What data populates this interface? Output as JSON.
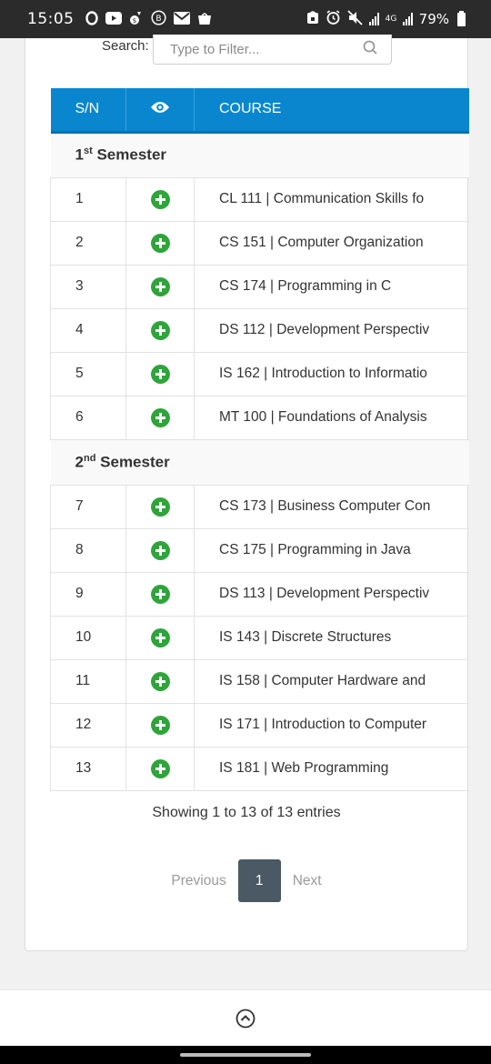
{
  "status_bar": {
    "time": "15:05",
    "left_icons": [
      "o-icon",
      "youtube-icon",
      "money-icon",
      "b-circle-icon",
      "gmail-icon",
      "shopping-bag-icon"
    ],
    "right_icons": [
      "lock-icon",
      "alarm-icon",
      "mute-icon",
      "signal-icon",
      "4g-signal-icon"
    ],
    "network": "4G",
    "battery": "79%"
  },
  "search": {
    "label": "Search:",
    "placeholder": "Type to Filter...",
    "value": ""
  },
  "table": {
    "columns": [
      "S/N",
      "eye-icon",
      "COURSE"
    ],
    "header_color": "#0a86cf",
    "groups": [
      {
        "title_num": "1",
        "title_sup": "st",
        "title_text": " Semester",
        "rows": [
          {
            "sn": "1",
            "course": "CL 111 | Communication Skills fo"
          },
          {
            "sn": "2",
            "course": "CS 151 | Computer Organization"
          },
          {
            "sn": "3",
            "course": "CS 174 | Programming in C"
          },
          {
            "sn": "4",
            "course": "DS 112 | Development Perspectiv"
          },
          {
            "sn": "5",
            "course": "IS 162 | Introduction to Informatio"
          },
          {
            "sn": "6",
            "course": "MT 100 | Foundations of Analysis"
          }
        ]
      },
      {
        "title_num": "2",
        "title_sup": "nd",
        "title_text": " Semester",
        "rows": [
          {
            "sn": "7",
            "course": "CS 173 | Business Computer Con"
          },
          {
            "sn": "8",
            "course": "CS 175 | Programming in Java"
          },
          {
            "sn": "9",
            "course": "DS 113 | Development Perspectiv"
          },
          {
            "sn": "10",
            "course": "IS 143 | Discrete Structures"
          },
          {
            "sn": "11",
            "course": "IS 158 | Computer Hardware and"
          },
          {
            "sn": "12",
            "course": "IS 171 | Introduction to Computer"
          },
          {
            "sn": "13",
            "course": "IS 181 | Web Programming"
          }
        ]
      }
    ],
    "row_action_icon": "plus-circle-icon",
    "action_color": "#2fa43a"
  },
  "info_text": "Showing 1 to 13 of 13 entries",
  "pagination": {
    "previous": "Previous",
    "current": "1",
    "next": "Next"
  },
  "bottom_bar": {
    "icon": "chevron-up-circle-icon"
  }
}
